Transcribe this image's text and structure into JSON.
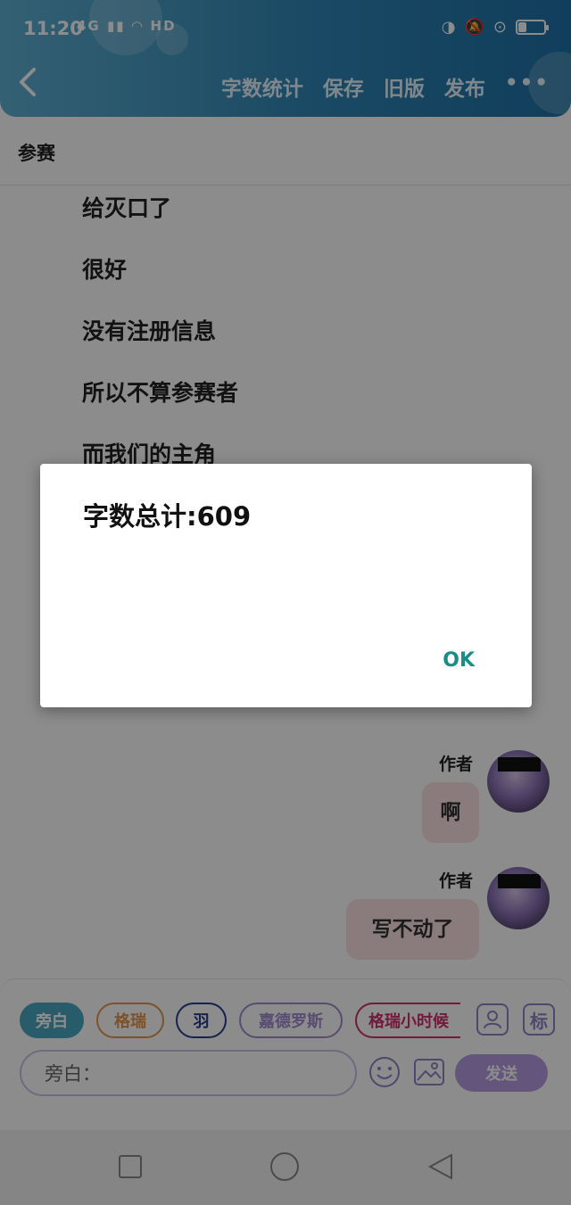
{
  "status": {
    "time": "11:20",
    "net_badge": "4G",
    "hd_badge": "HD"
  },
  "toolbar": {
    "actions": [
      "字数统计",
      "保存",
      "旧版",
      "发布"
    ],
    "more": "•••"
  },
  "chapter_title": "参赛",
  "story_lines": [
    "给灭口了",
    "很好",
    "没有注册信息",
    "所以不算参赛者",
    "而我们的主角"
  ],
  "messages": [
    {
      "author": "作者",
      "text": "啊"
    },
    {
      "author": "作者",
      "text": "写不动了"
    }
  ],
  "composer": {
    "roles": [
      "旁白",
      "格瑞",
      "羽",
      "嘉德罗斯",
      "格瑞小时候"
    ],
    "role_colors": [
      "#4aa8c4",
      "#e6954a",
      "#2b3d8c",
      "#a08ad2",
      "#d0306a"
    ],
    "icon_avatar_label": "",
    "icon_tag_label": "标",
    "input_placeholder": "旁白：",
    "send_label": "发送"
  },
  "dialog": {
    "title": "字数总计:609",
    "ok_label": "OK"
  }
}
